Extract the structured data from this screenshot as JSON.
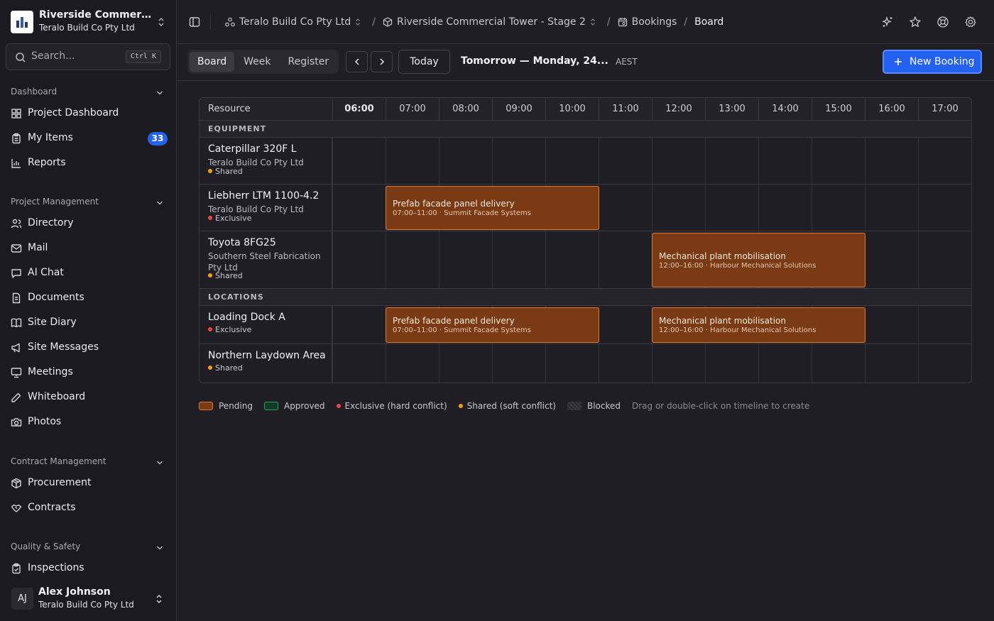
{
  "project": {
    "name": "Riverside Commercial Tower - Stage 2",
    "org": "Teralo Build Co Pty Ltd"
  },
  "search": {
    "placeholder": "Search...",
    "shortcut": "Ctrl K"
  },
  "sidebar": {
    "sections": [
      {
        "title": "Dashboard",
        "items": [
          {
            "label": "Project Dashboard",
            "icon": "dashboard-icon"
          },
          {
            "label": "My Items",
            "icon": "clipboard-icon",
            "badge": "33"
          },
          {
            "label": "Reports",
            "icon": "chart-icon"
          }
        ]
      },
      {
        "title": "Project Management",
        "items": [
          {
            "label": "Directory",
            "icon": "users-icon"
          },
          {
            "label": "Mail",
            "icon": "mail-icon"
          },
          {
            "label": "AI Chat",
            "icon": "chat-icon"
          },
          {
            "label": "Documents",
            "icon": "document-icon"
          },
          {
            "label": "Site Diary",
            "icon": "book-icon"
          },
          {
            "label": "Site Messages",
            "icon": "megaphone-icon"
          },
          {
            "label": "Meetings",
            "icon": "presentation-icon"
          },
          {
            "label": "Whiteboard",
            "icon": "pen-icon"
          },
          {
            "label": "Photos",
            "icon": "camera-icon"
          }
        ]
      },
      {
        "title": "Contract Management",
        "items": [
          {
            "label": "Procurement",
            "icon": "package-icon"
          },
          {
            "label": "Contracts",
            "icon": "handshake-icon"
          }
        ]
      },
      {
        "title": "Quality & Safety",
        "items": [
          {
            "label": "Inspections",
            "icon": "clipboard-check-icon"
          }
        ]
      }
    ]
  },
  "user": {
    "initials": "AJ",
    "name": "Alex Johnson",
    "org": "Teralo Build Co Pty Ltd"
  },
  "breadcrumbs": [
    {
      "label": "Teralo Build Co Pty Ltd",
      "icon": "org-icon"
    },
    {
      "label": "Riverside Commercial Tower - Stage 2",
      "icon": "box-icon"
    },
    {
      "label": "Bookings",
      "icon": "calendar-icon"
    },
    {
      "label": "Board"
    }
  ],
  "toolbar": {
    "views": [
      "Board",
      "Week",
      "Register"
    ],
    "active_view": "Board",
    "today_label": "Today",
    "date_label": "Tomorrow — Monday, 24...",
    "timezone": "AEST",
    "new_booking_label": "New Booking",
    "accent_color": "#2461f2"
  },
  "board": {
    "resource_header": "Resource",
    "hours": [
      "06:00",
      "07:00",
      "08:00",
      "09:00",
      "10:00",
      "11:00",
      "12:00",
      "13:00",
      "14:00",
      "15:00",
      "16:00",
      "17:00"
    ],
    "current_hour": "06:00",
    "groups": [
      {
        "title": "EQUIPMENT",
        "rows": [
          {
            "name": "Caterpillar 320F L",
            "org": "Teralo Build Co Pty Ltd",
            "mode": "Shared",
            "bookings": []
          },
          {
            "name": "Liebherr LTM 1100-4.2",
            "org": "Teralo Build Co Pty Ltd",
            "mode": "Exclusive",
            "bookings": [
              {
                "title": "Prefab facade panel delivery",
                "detail": "07:00–11:00 · Summit Facade Systems",
                "start": "07:00",
                "end": "11:00",
                "status": "Pending"
              }
            ]
          },
          {
            "name": "Toyota 8FG25",
            "org": "Southern Steel Fabrication Pty Ltd",
            "mode": "Shared",
            "bookings": [
              {
                "title": "Mechanical plant mobilisation",
                "detail": "12:00–16:00 · Harbour Mechanical Solutions",
                "start": "12:00",
                "end": "16:00",
                "status": "Pending"
              }
            ]
          }
        ]
      },
      {
        "title": "LOCATIONS",
        "rows": [
          {
            "name": "Loading Dock A",
            "org": "",
            "mode": "Exclusive",
            "bookings": [
              {
                "title": "Prefab facade panel delivery",
                "detail": "07:00–11:00 · Summit Facade Systems",
                "start": "07:00",
                "end": "11:00",
                "status": "Pending"
              },
              {
                "title": "Mechanical plant mobilisation",
                "detail": "12:00–16:00 · Harbour Mechanical Solutions",
                "start": "12:00",
                "end": "16:00",
                "status": "Pending"
              }
            ]
          },
          {
            "name": "Northern Laydown Area",
            "org": "",
            "mode": "Shared",
            "bookings": []
          }
        ]
      }
    ]
  },
  "legend": {
    "pending": "Pending",
    "approved": "Approved",
    "exclusive": "Exclusive (hard conflict)",
    "shared": "Shared (soft conflict)",
    "blocked": "Blocked",
    "hint": "Drag or double-click on timeline to create"
  },
  "colors": {
    "pending": "#e07a33",
    "approved": "#22a35a",
    "exclusive": "#ef4444",
    "shared": "#f59e0b"
  }
}
